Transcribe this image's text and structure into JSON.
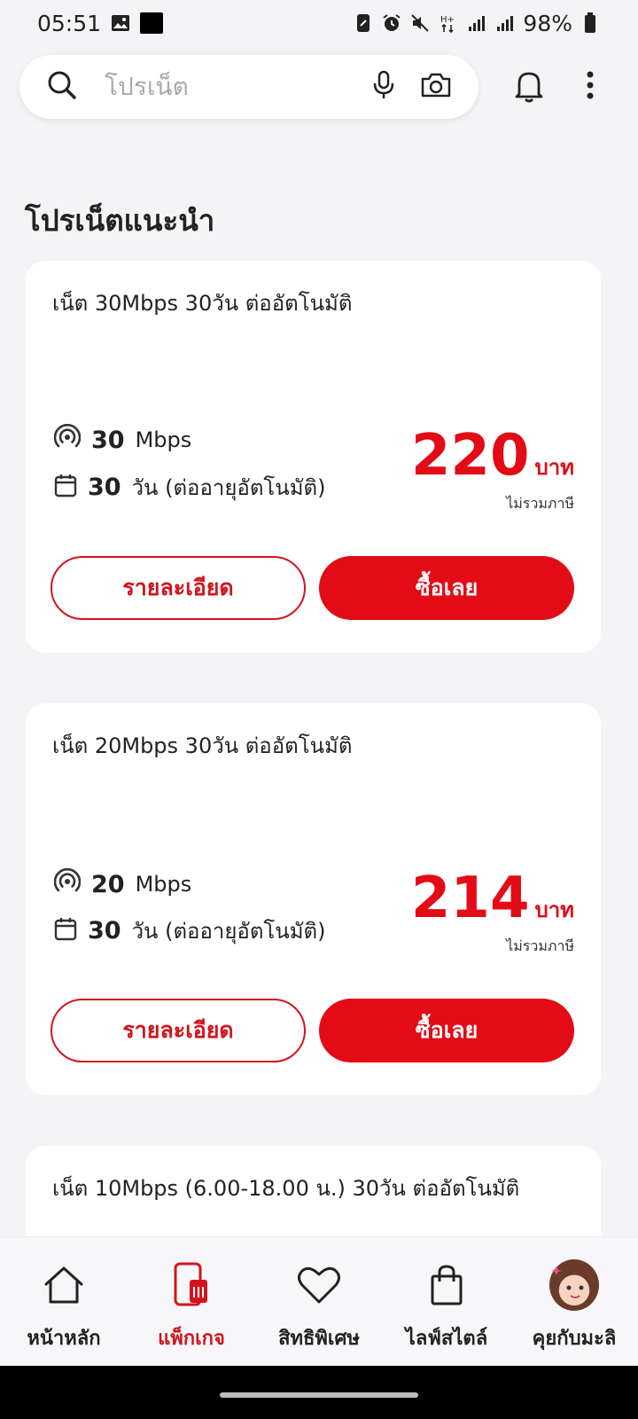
{
  "status_bar": {
    "time": "05:51",
    "battery": "98%"
  },
  "search": {
    "placeholder": "โปรเน็ต"
  },
  "section_title": "โปรเน็ตแนะนำ",
  "packages": [
    {
      "title": "เน็ต 30Mbps 30วัน ต่ออัตโนมัติ",
      "speed_value": "30",
      "speed_unit": "Mbps",
      "days_value": "30",
      "days_text": "วัน (ต่ออายุอัตโนมัติ)",
      "price": "220",
      "currency": "บาท",
      "tax_note": "ไม่รวมภาษี",
      "detail_label": "รายละเอียด",
      "buy_label": "ซื้อเลย"
    },
    {
      "title": "เน็ต 20Mbps 30วัน ต่ออัตโนมัติ",
      "speed_value": "20",
      "speed_unit": "Mbps",
      "days_value": "30",
      "days_text": "วัน (ต่ออายุอัตโนมัติ)",
      "price": "214",
      "currency": "บาท",
      "tax_note": "ไม่รวมภาษี",
      "detail_label": "รายละเอียด",
      "buy_label": "ซื้อเลย"
    },
    {
      "title": "เน็ต 10Mbps (6.00-18.00 น.) 30วัน ต่ออัตโนมัติ"
    }
  ],
  "bottom_nav": {
    "items": [
      {
        "label": "หน้าหลัก",
        "icon": "home-icon"
      },
      {
        "label": "แพ็กเกจ",
        "icon": "package-icon",
        "active": true
      },
      {
        "label": "สิทธิพิเศษ",
        "icon": "heart-icon"
      },
      {
        "label": "ไลฟ์สไตล์",
        "icon": "shopping-bag-icon"
      },
      {
        "label": "คุยกับมะลิ",
        "icon": "avatar-icon"
      }
    ]
  },
  "colors": {
    "accent": "#e20b16",
    "background": "#f4f4f6"
  }
}
